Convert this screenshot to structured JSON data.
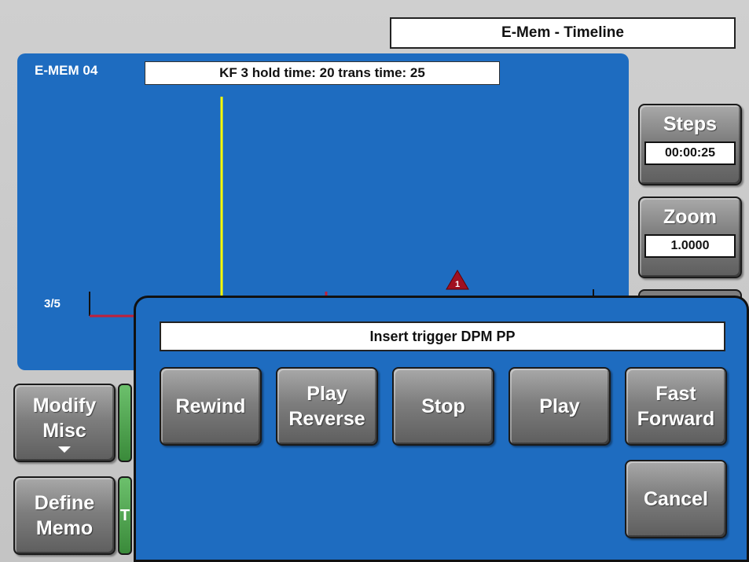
{
  "title": "E-Mem - Timeline",
  "panel": {
    "label": "E-MEM 04",
    "info": "KF 3 hold time: 20 trans time: 25",
    "track_label": "3/5",
    "marker_label": "1"
  },
  "side": {
    "steps_label": "Steps",
    "steps_value": "00:00:25",
    "zoom_label": "Zoom",
    "zoom_value": "1.0000"
  },
  "left_buttons": {
    "modify_line1": "Modify",
    "modify_line2": "Misc",
    "define_line1": "Define",
    "define_line2": "Memo",
    "green_stub_letter": "T"
  },
  "dialog": {
    "header": "Insert trigger DPM PP",
    "rewind": "Rewind",
    "play_reverse_line1": "Play",
    "play_reverse_line2": "Reverse",
    "stop": "Stop",
    "play": "Play",
    "fast_forward_line1": "Fast",
    "fast_forward_line2": "Forward",
    "cancel": "Cancel"
  },
  "colors": {
    "panel_blue": "#1e6cc0",
    "cursor_yellow": "#ffff00",
    "track_red": "#c0203a",
    "marker_red": "#a01020"
  }
}
